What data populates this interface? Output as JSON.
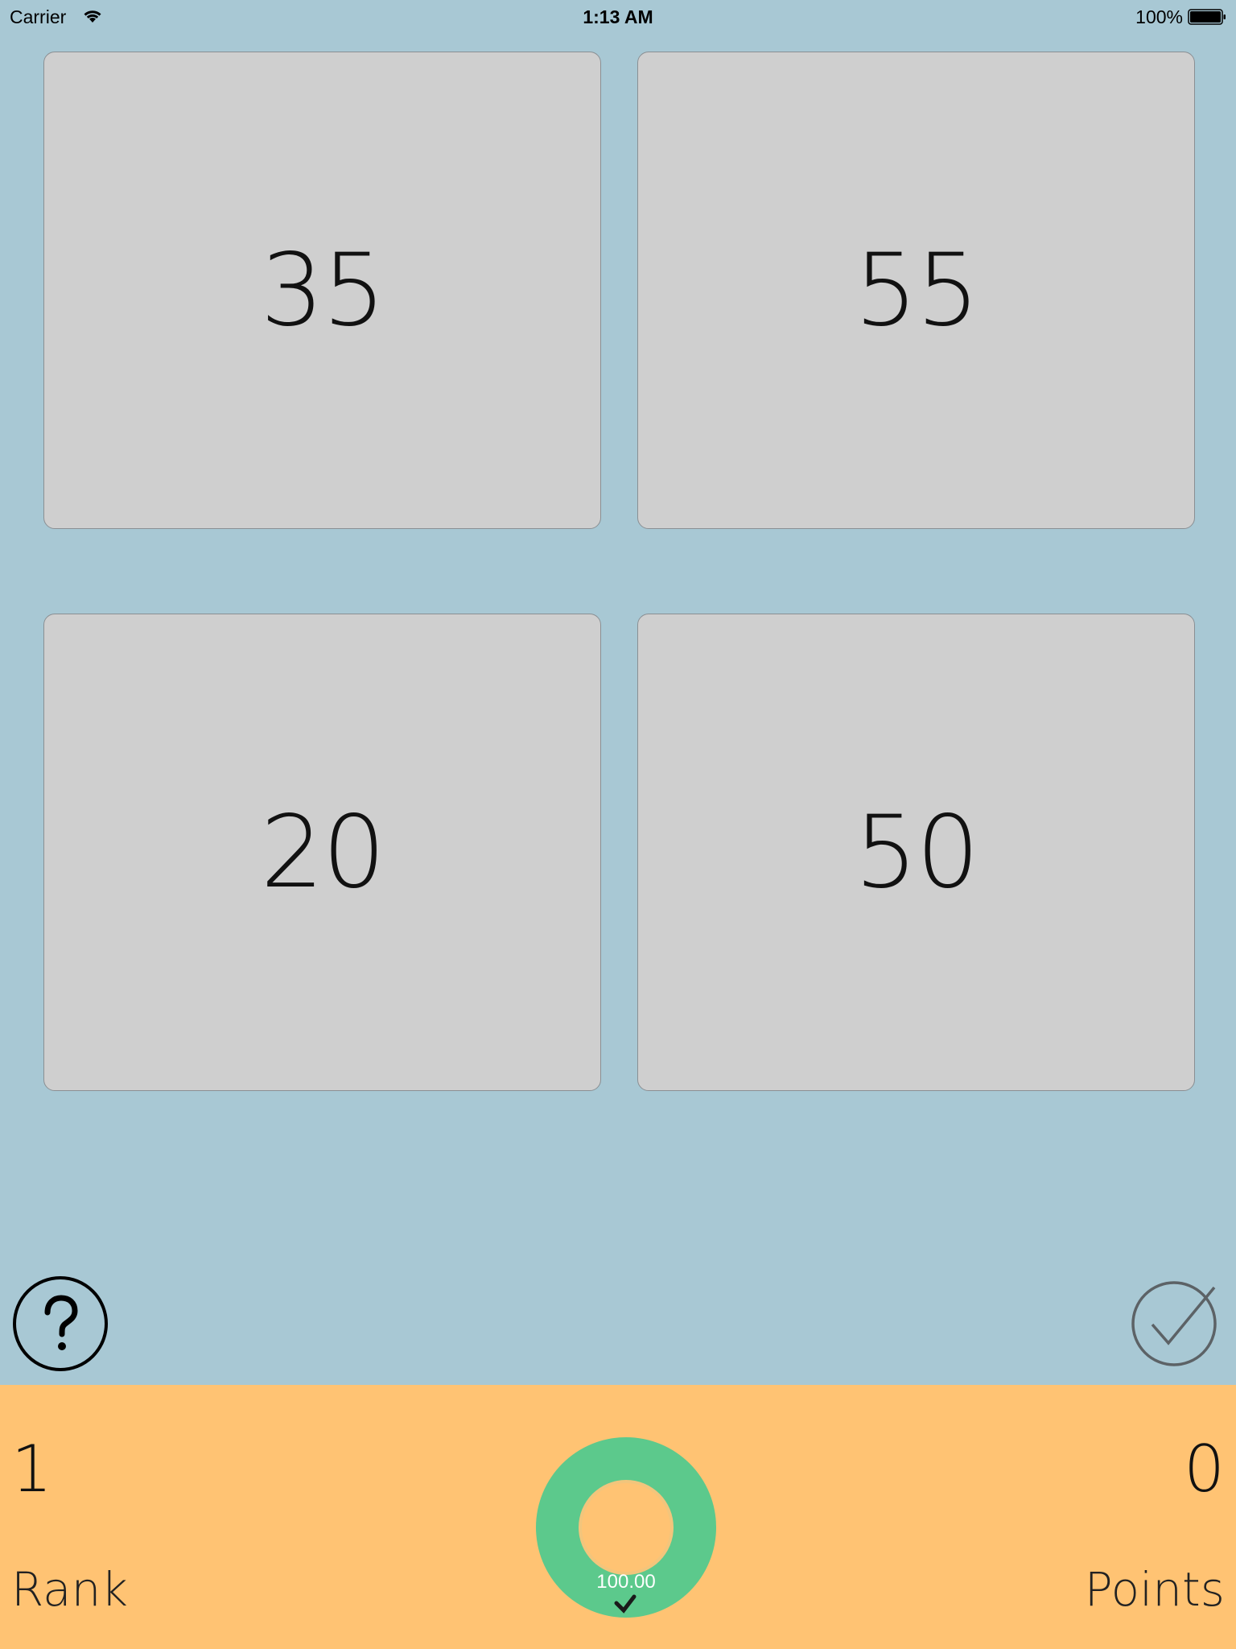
{
  "status_bar": {
    "carrier": "Carrier",
    "time": "1:13 AM",
    "battery": "100%"
  },
  "tiles": [
    {
      "value": "35"
    },
    {
      "value": "55"
    },
    {
      "value": "20"
    },
    {
      "value": "50"
    }
  ],
  "controls": {
    "help_icon": "question-circle-icon",
    "confirm_icon": "check-circle-icon"
  },
  "footer": {
    "rank_value": "1",
    "rank_label": "Rank",
    "points_value": "0",
    "points_label": "Points",
    "timer_value": "100.00",
    "timer_progress": 1.0
  },
  "colors": {
    "background": "#a8c8d4",
    "tile": "#cfcfcf",
    "footer": "#ffc373",
    "timer_ring": "#5cc98c"
  }
}
